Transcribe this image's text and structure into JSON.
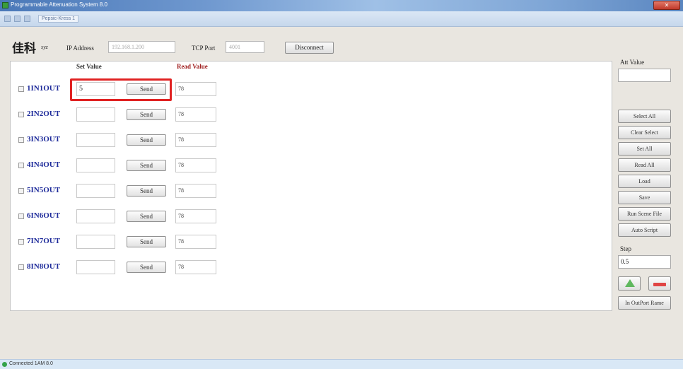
{
  "window": {
    "title": "Programmable Attenuation System 8.0",
    "close_label": "✕"
  },
  "toolbar": {
    "tab_label": "Pepsic-Kress 1"
  },
  "header": {
    "logo_text": "佳科",
    "logo_sub": "syz",
    "ip_label": "IP Address",
    "ip_value": "192.168.1.200",
    "port_label": "TCP Port",
    "port_value": "4001",
    "disconnect_label": "Disconnect"
  },
  "columns": {
    "set_value": "Set Value",
    "read_value": "Read Value"
  },
  "channels": [
    {
      "name": "1IN1OUT",
      "set_value": "5",
      "send_label": "Send",
      "read_value": "78"
    },
    {
      "name": "2IN2OUT",
      "set_value": "",
      "send_label": "Send",
      "read_value": "78"
    },
    {
      "name": "3IN3OUT",
      "set_value": "",
      "send_label": "Send",
      "read_value": "78"
    },
    {
      "name": "4IN4OUT",
      "set_value": "",
      "send_label": "Send",
      "read_value": "78"
    },
    {
      "name": "5IN5OUT",
      "set_value": "",
      "send_label": "Send",
      "read_value": "78"
    },
    {
      "name": "6IN6OUT",
      "set_value": "",
      "send_label": "Send",
      "read_value": "78"
    },
    {
      "name": "7IN7OUT",
      "set_value": "",
      "send_label": "Send",
      "read_value": "78"
    },
    {
      "name": "8IN8OUT",
      "set_value": "",
      "send_label": "Send",
      "read_value": "78"
    }
  ],
  "sidebar": {
    "att_value_label": "Att Value",
    "att_value": "",
    "buttons": [
      "Select All",
      "Clear Select",
      "Set All",
      "Read All",
      "Load",
      "Save",
      "Run Scene File",
      "Auto Script"
    ],
    "step_label": "Step",
    "step_value": "0.5",
    "inout_label": "In OutPort Rame"
  },
  "status": {
    "text": "Connected 1AM 8.0"
  },
  "colors": {
    "highlight": "#e02222",
    "channel_text": "#1d2a9a",
    "read_header": "#a02020"
  }
}
